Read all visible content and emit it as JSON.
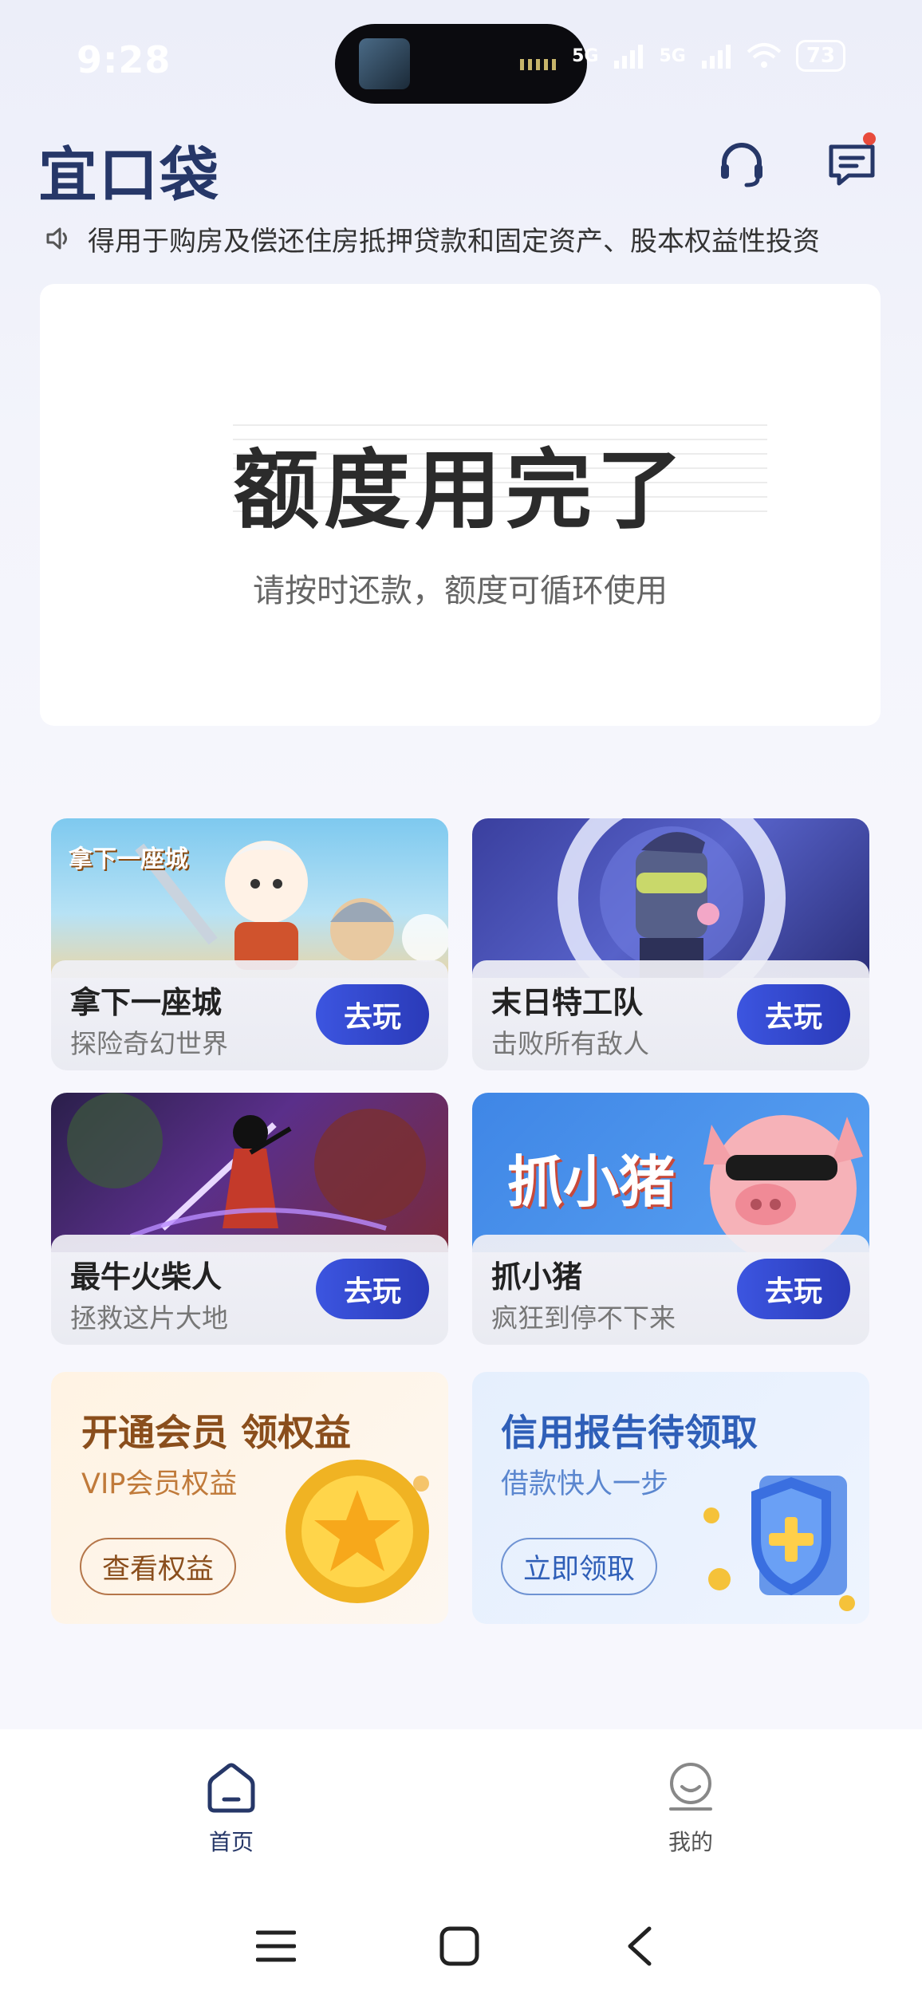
{
  "status_bar": {
    "time": "9:28",
    "network1": "5G",
    "network2": "5G",
    "battery": "73"
  },
  "header": {
    "logo": "宜口袋"
  },
  "notice": {
    "text": "得用于购房及偿还住房抵押贷款和固定资产、股本权益性投资"
  },
  "quota": {
    "title": "额度用完了",
    "subtitle": "请按时还款，额度可循环使用"
  },
  "games": [
    {
      "name": "拿下一座城",
      "desc": "探险奇幻世界",
      "button": "去玩",
      "art_label": "拿下一座城"
    },
    {
      "name": "末日特工队",
      "desc": "击败所有敌人",
      "button": "去玩"
    },
    {
      "name": "最牛火柴人",
      "desc": "拯救这片大地",
      "button": "去玩"
    },
    {
      "name": "抓小猪",
      "desc": "疯狂到停不下来",
      "button": "去玩",
      "art_label": "抓小猪"
    }
  ],
  "promos": {
    "vip": {
      "title": "开通会员 领权益",
      "subtitle": "VIP会员权益",
      "button": "查看权益"
    },
    "credit": {
      "title": "信用报告待领取",
      "subtitle": "借款快人一步",
      "button": "立即领取"
    }
  },
  "tabbar": {
    "home": "首页",
    "mine": "我的"
  },
  "colors": {
    "brand": "#263768",
    "play_button": "#3347d6",
    "vip_text": "#8a4e1c",
    "credit_text": "#2f5fb8"
  }
}
